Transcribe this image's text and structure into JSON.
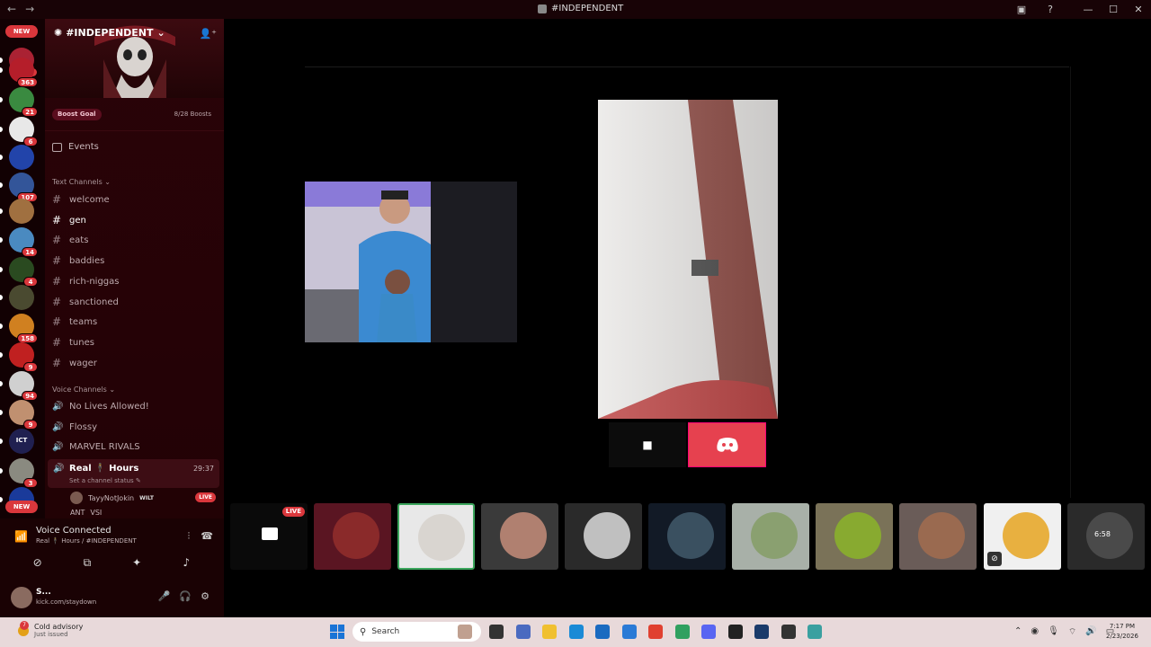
{
  "window": {
    "title": "#INDEPENDENT",
    "nav_back": "←",
    "nav_fwd": "→"
  },
  "rail": {
    "new_top": "NEW",
    "new_bottom": "NEW",
    "servers": [
      {
        "badge": "4",
        "color": "#aa2233"
      },
      {
        "badge": "363",
        "color": "#b51e2a"
      },
      {
        "badge": "21",
        "color": "#3a8a40"
      },
      {
        "badge": "6",
        "color": "#e8e8e8"
      },
      {
        "badge": "",
        "color": "#2244aa"
      },
      {
        "badge": "107",
        "color": "#335599"
      },
      {
        "badge": "",
        "color": "#a07040"
      },
      {
        "badge": "14",
        "color": "#4a8ac0"
      },
      {
        "badge": "4",
        "color": "#2a4a20"
      },
      {
        "badge": "",
        "color": "#4a4a30"
      },
      {
        "badge": "158",
        "color": "#d08020"
      },
      {
        "badge": "9",
        "color": "#c02020"
      },
      {
        "badge": "94",
        "color": "#d0d0d0"
      },
      {
        "badge": "9",
        "color": "#c09070"
      },
      {
        "badge": "",
        "color": "#202050",
        "label": "ICT"
      },
      {
        "badge": "3",
        "color": "#8a8a80"
      },
      {
        "badge": "",
        "color": "#1a3a9a"
      }
    ]
  },
  "sidebar": {
    "server_name": "#INDEPENDENT",
    "boost_goal": "Boost Goal",
    "boost_count": "8/28 Boosts",
    "events": "Events",
    "text_category": "Text Channels",
    "text_channels": [
      "welcome",
      "gen",
      "eats",
      "baddies",
      "rich-niggas",
      "sanctioned",
      "teams",
      "tunes",
      "wager"
    ],
    "active_channel": "gen",
    "voice_category": "Voice Channels",
    "voice_channels": [
      "No Lives Allowed!",
      "Flossy",
      "MARVEL RIVALS"
    ],
    "active_voice": {
      "name": "Real 🕴 Hours",
      "timer": "29:37",
      "status": "Set a channel status ✎"
    },
    "members": [
      {
        "name": "TayyNotJokin",
        "tag": "WILT",
        "live": "LIVE"
      },
      {
        "name": "ANT",
        "tag": "VSI"
      }
    ]
  },
  "panel": {
    "voice_title": "Voice Connected",
    "voice_sub": "Real 🕴 Hours / #INDEPENDENT",
    "user_name": "S...",
    "user_status": "kick.com/staydown"
  },
  "stage": {
    "thumb_live": "LIVE",
    "thumb_label_last": "6:58"
  },
  "taskbar": {
    "weather_title": "Cold advisory",
    "weather_sub": "Just issued",
    "weather_badge": "7",
    "search_placeholder": "Search",
    "time": "7:17 PM",
    "date": "2/23/2026"
  },
  "colors": {
    "accent": "#da373c",
    "discord_red": "#e6414f",
    "sidebar_bg": "#2a0308"
  }
}
